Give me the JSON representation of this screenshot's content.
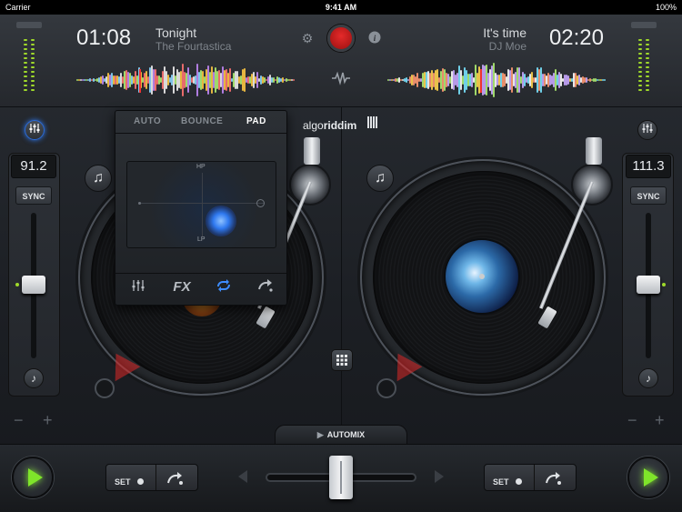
{
  "status_bar": {
    "carrier": "Carrier",
    "time": "9:41 AM",
    "battery": "100%"
  },
  "deck_left": {
    "elapsed": "01:08",
    "title": "Tonight",
    "artist": "The Fourtastica",
    "bpm": "91.2",
    "sync_label": "SYNC",
    "set_label": "SET"
  },
  "deck_right": {
    "remaining": "02:20",
    "title": "It's time",
    "artist": "DJ Moe",
    "bpm": "111.3",
    "sync_label": "SYNC",
    "set_label": "SET"
  },
  "logo": {
    "thin": "algo",
    "bold": "riddim"
  },
  "fx_panel": {
    "tabs": [
      "AUTO",
      "BOUNCE",
      "PAD"
    ],
    "active_tab": "PAD",
    "pad_top_label": "HP",
    "pad_bottom_label": "LP",
    "bottom_fx_label": "FX"
  },
  "automix_label": "AUTOMIX",
  "minus": "−",
  "plus": "+",
  "colors": {
    "accent_green": "#7fe52a",
    "record_red": "#d42020",
    "fx_blue": "#2f79f0"
  }
}
